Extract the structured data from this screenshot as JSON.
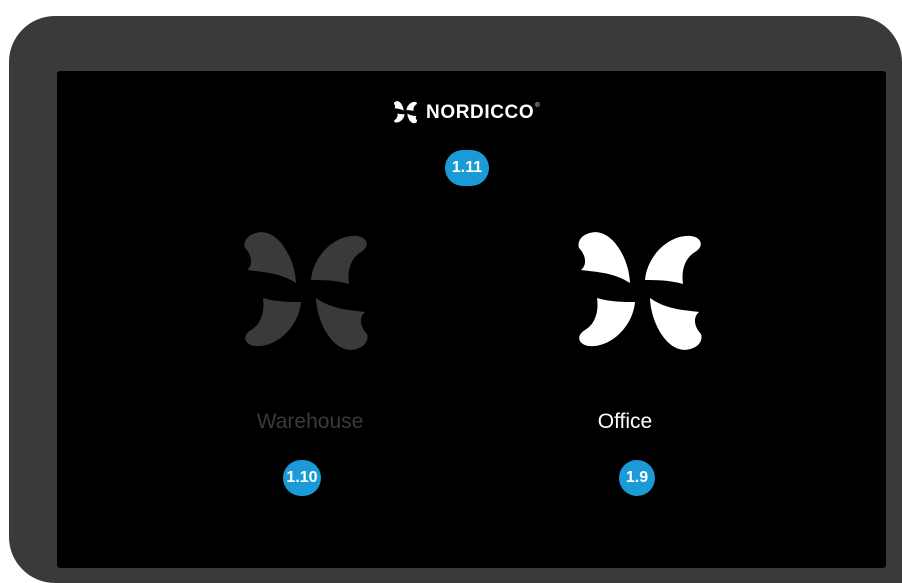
{
  "brand": {
    "name": "NORDICCO",
    "registered_mark": "®",
    "icon": "nordicco-pinwheel-logo-icon"
  },
  "annotations": {
    "brand_badge": "1.11",
    "warehouse_badge": "1.10",
    "office_badge": "1.9"
  },
  "locations": [
    {
      "label": "Warehouse",
      "icon": "pinwheel-icon",
      "state": "inactive",
      "color": "#3a3a3a"
    },
    {
      "label": "Office",
      "icon": "pinwheel-icon",
      "state": "active",
      "color": "#ffffff"
    }
  ],
  "colors": {
    "bezel": "#3a3a3a",
    "screen": "#000000",
    "badge": "#1a9bd8",
    "active": "#ffffff",
    "inactive": "#3a3a3a"
  }
}
